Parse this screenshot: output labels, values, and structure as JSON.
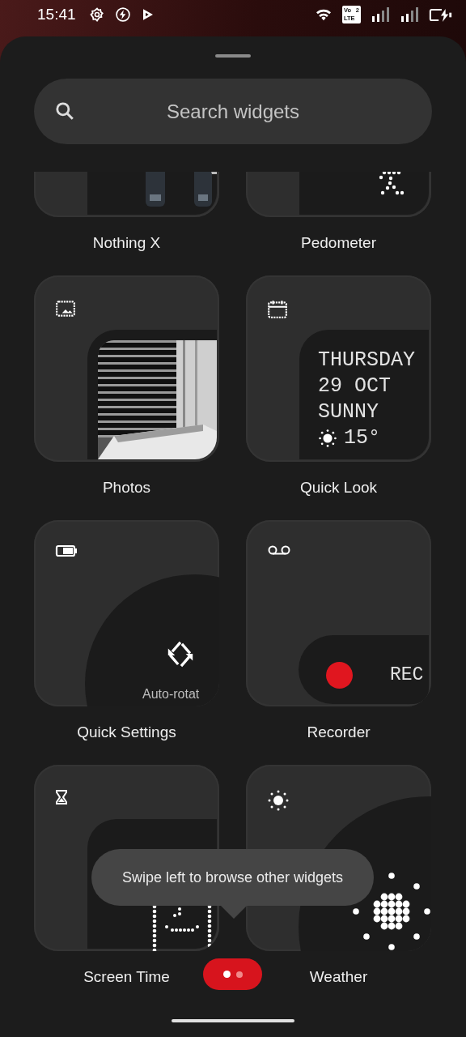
{
  "status_bar": {
    "time": "15:41",
    "network_badge": {
      "top": "Vo",
      "index": "2",
      "bottom": "LTE"
    }
  },
  "search": {
    "placeholder": "Search widgets"
  },
  "widgets": [
    {
      "name": "Nothing X",
      "kind": "earbuds"
    },
    {
      "name": "Pedometer",
      "kind": "pedometer"
    },
    {
      "name": "Photos"
    },
    {
      "name": "Quick Look",
      "kind": "quicklook",
      "lines": [
        "THURSDAY",
        "29 OCT",
        "SUNNY"
      ],
      "temperature": "15°"
    },
    {
      "name": "Quick Settings",
      "kind": "tile",
      "tile_label": "Auto-rotat"
    },
    {
      "name": "Recorder",
      "kind": "recorder",
      "status": "REC"
    },
    {
      "name": "Screen Time",
      "kind": "screentime"
    },
    {
      "name": "Weather",
      "kind": "weather"
    }
  ],
  "tooltip": "Swipe left to browse other widgets",
  "pager": [
    {
      "selected": true
    },
    {
      "selected": false
    }
  ]
}
